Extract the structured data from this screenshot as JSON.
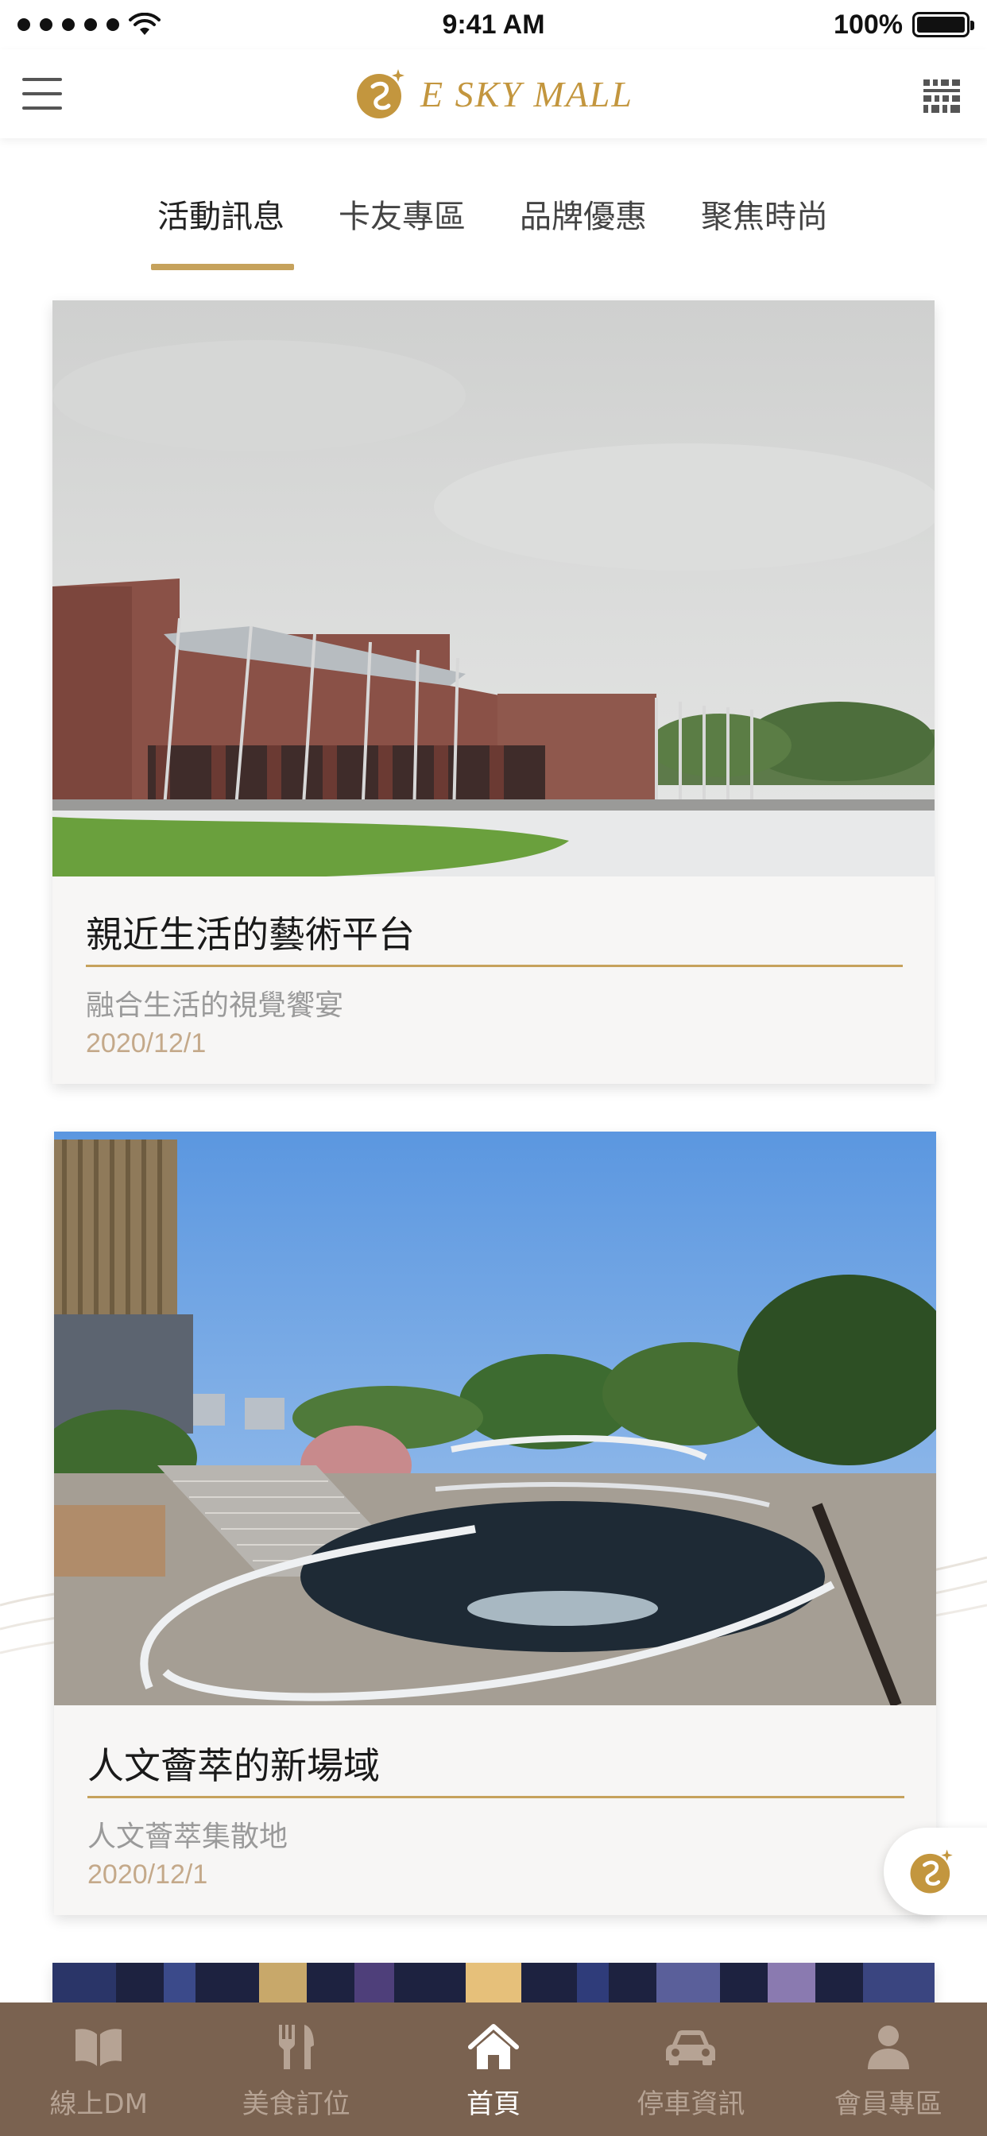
{
  "status_bar": {
    "time": "9:41 AM",
    "battery": "100%"
  },
  "header": {
    "logo_text": "E SKY MALL"
  },
  "tabs": [
    {
      "label": "活動訊息",
      "active": true
    },
    {
      "label": "卡友專區",
      "active": false
    },
    {
      "label": "品牌優惠",
      "active": false
    },
    {
      "label": "聚焦時尚",
      "active": false
    }
  ],
  "cards": [
    {
      "title": "親近生活的藝術平台",
      "subtitle": "融合生活的視覺饗宴",
      "date": "2020/12/1"
    },
    {
      "title": "人文薈萃的新場域",
      "subtitle": "人文薈萃集散地",
      "date": "2020/12/1"
    }
  ],
  "bottom_nav": [
    {
      "label": "線上DM",
      "icon": "book-icon",
      "active": false
    },
    {
      "label": "美食訂位",
      "icon": "fork-knife-icon",
      "active": false
    },
    {
      "label": "首頁",
      "icon": "home-icon",
      "active": true
    },
    {
      "label": "停車資訊",
      "icon": "car-icon",
      "active": false
    },
    {
      "label": "會員專區",
      "icon": "person-icon",
      "active": false
    }
  ],
  "colors": {
    "accent_gold": "#c6a25c",
    "nav_background": "#7a6250",
    "card_background": "#f7f6f5"
  }
}
